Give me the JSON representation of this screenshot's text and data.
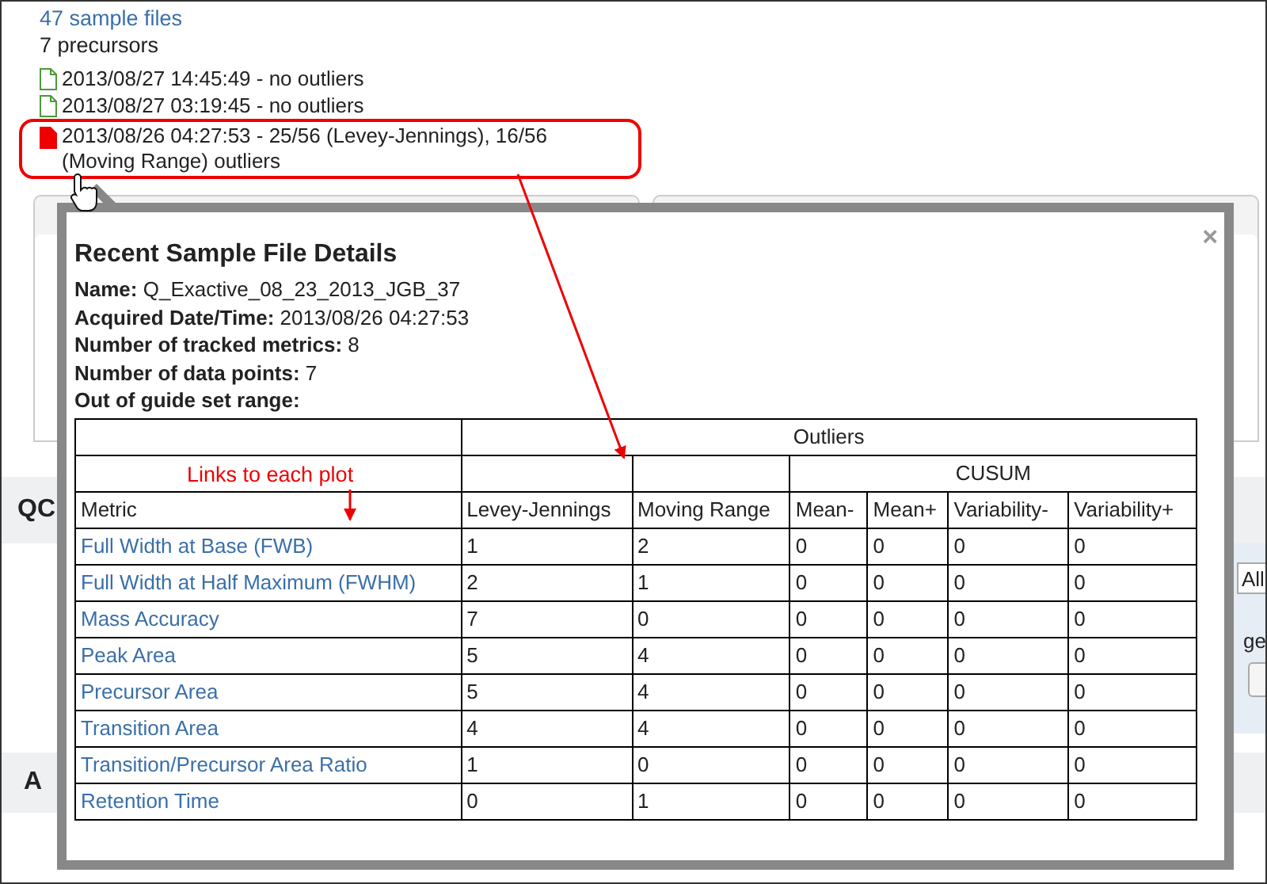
{
  "summary": {
    "sample_files_link": "47 sample files",
    "precursors": "7 precursors"
  },
  "sample_files": [
    {
      "text": "2013/08/27 14:45:49 - no outliers",
      "outliers": false
    },
    {
      "text": "2013/08/27 03:19:45 - no outliers",
      "outliers": false
    },
    {
      "text": "2013/08/26 04:27:53 - 25/56 (Levey-Jennings), 16/56 (Moving Range) outliers",
      "outliers": true
    }
  ],
  "background": {
    "section_title": "QC",
    "dropdown_value": "All",
    "field_label": "ge",
    "second_section_title": "A"
  },
  "popup": {
    "title": "Recent Sample File Details",
    "close": "×",
    "details": [
      {
        "label": "Name:",
        "value": "Q_Exactive_08_23_2013_JGB_37"
      },
      {
        "label": "Acquired Date/Time:",
        "value": "2013/08/26 04:27:53"
      },
      {
        "label": "Number of tracked metrics:",
        "value": "8"
      },
      {
        "label": "Number of data points:",
        "value": "7"
      },
      {
        "label": "Out of guide set range:"
      }
    ],
    "table": {
      "group_header": "Outliers",
      "subgroup_header": "CUSUM",
      "columns": [
        "Metric",
        "Levey-Jennings",
        "Moving Range",
        "Mean-",
        "Mean+",
        "Variability-",
        "Variability+"
      ],
      "rows": [
        {
          "metric": "Full Width at Base (FWB)",
          "values": [
            "1",
            "2",
            "0",
            "0",
            "0",
            "0"
          ]
        },
        {
          "metric": "Full Width at Half Maximum (FWHM)",
          "values": [
            "2",
            "1",
            "0",
            "0",
            "0",
            "0"
          ]
        },
        {
          "metric": "Mass Accuracy",
          "values": [
            "7",
            "0",
            "0",
            "0",
            "0",
            "0"
          ]
        },
        {
          "metric": "Peak Area",
          "values": [
            "5",
            "4",
            "0",
            "0",
            "0",
            "0"
          ]
        },
        {
          "metric": "Precursor Area",
          "values": [
            "5",
            "4",
            "0",
            "0",
            "0",
            "0"
          ]
        },
        {
          "metric": "Transition Area",
          "values": [
            "4",
            "4",
            "0",
            "0",
            "0",
            "0"
          ]
        },
        {
          "metric": "Transition/Precursor Area Ratio",
          "values": [
            "1",
            "0",
            "0",
            "0",
            "0",
            "0"
          ]
        },
        {
          "metric": "Retention Time",
          "values": [
            "0",
            "1",
            "0",
            "0",
            "0",
            "0"
          ]
        }
      ]
    }
  },
  "annotation": {
    "text": "Links to each plot"
  }
}
